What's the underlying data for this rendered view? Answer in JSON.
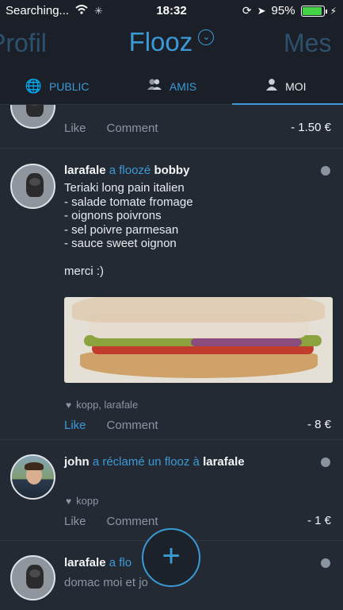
{
  "status": {
    "carrier": "Searching...",
    "time": "18:32",
    "battery": "95%",
    "battery_level": 0.95
  },
  "header": {
    "prev": "Profil",
    "title": "Flooz",
    "next": "Mes"
  },
  "tabs": [
    {
      "label": "PUBLIC",
      "icon": "globe-icon"
    },
    {
      "label": "AMIS",
      "icon": "friends-icon"
    },
    {
      "label": "MOI",
      "icon": "user-icon"
    }
  ],
  "feed": [
    {
      "actions": {
        "like": "Like",
        "comment": "Comment"
      },
      "amount": "- 1.50 €"
    },
    {
      "actor": "larafale",
      "verb": "a floozé",
      "target": "bobby",
      "text": "Teriaki long pain italien\n- salade tomate fromage\n- oignons poivrons\n- sel poivre parmesan\n- sauce sweet oignon\n\nmerci :)",
      "likes": "kopp, larafale",
      "actions": {
        "like": "Like",
        "comment": "Comment"
      },
      "amount": "- 8 €"
    },
    {
      "actor": "john",
      "verb": "a réclamé un flooz à",
      "target": "larafale",
      "likes": "kopp",
      "actions": {
        "like": "Like",
        "comment": "Comment"
      },
      "amount": "- 1 €"
    },
    {
      "actor": "larafale",
      "verb": "a flo",
      "text": "domac moi et jo"
    }
  ],
  "fab": {
    "label": "+"
  }
}
